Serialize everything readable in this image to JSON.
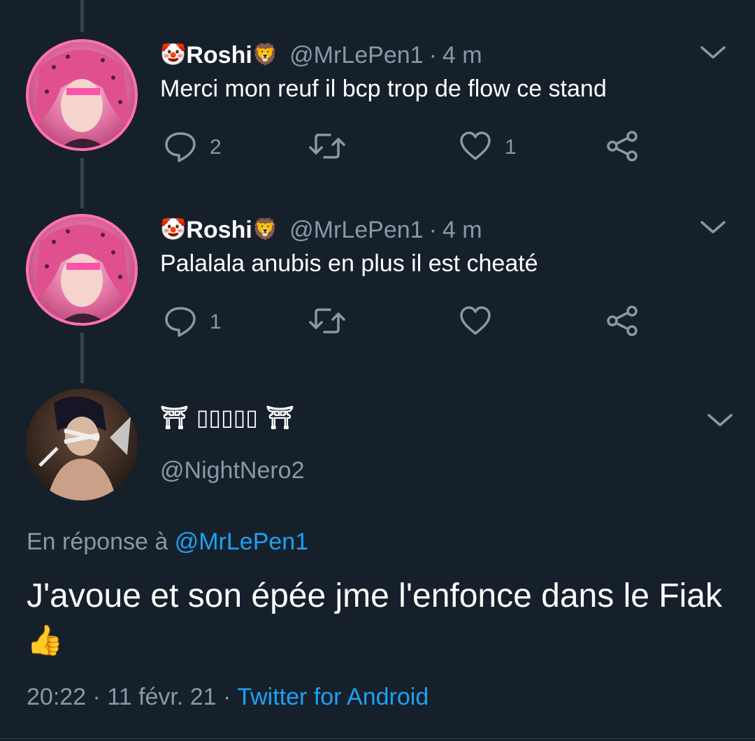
{
  "tweets": [
    {
      "name_prefix_emoji": "🤡",
      "name": "Roshi",
      "name_suffix_emoji": "🦁",
      "handle": "@MrLePen1",
      "separator": "·",
      "time": "4 m",
      "text": "Merci mon reuf il bcp trop de flow ce stand",
      "reply_count": "2",
      "retweet_count": "",
      "like_count": "1"
    },
    {
      "name_prefix_emoji": "🤡",
      "name": "Roshi",
      "name_suffix_emoji": "🦁",
      "handle": "@MrLePen1",
      "separator": "·",
      "time": "4 m",
      "text": "Palalala anubis en plus il est cheaté",
      "reply_count": "1",
      "retweet_count": "",
      "like_count": ""
    }
  ],
  "main_tweet": {
    "display_name": "⛩ ▯▯▯▯▯ ⛩",
    "handle": "@NightNero2",
    "reply_label": "En réponse à",
    "reply_to": "@MrLePen1",
    "text": "J'avoue et son épée jme l'enfonce dans le Fiak",
    "text_emoji": "👍",
    "time": "20:22",
    "separator1": "·",
    "date": "11 févr. 21",
    "separator2": "·",
    "client": "Twitter for Android"
  },
  "icons": {
    "reply": "reply-icon",
    "retweet": "retweet-icon",
    "like": "heart-icon",
    "share": "share-icon",
    "menu": "chevron-down-icon"
  },
  "colors": {
    "background": "#15202b",
    "secondary_text": "#8899a6",
    "accent": "#1da1f2",
    "thread_line": "#38444d"
  }
}
